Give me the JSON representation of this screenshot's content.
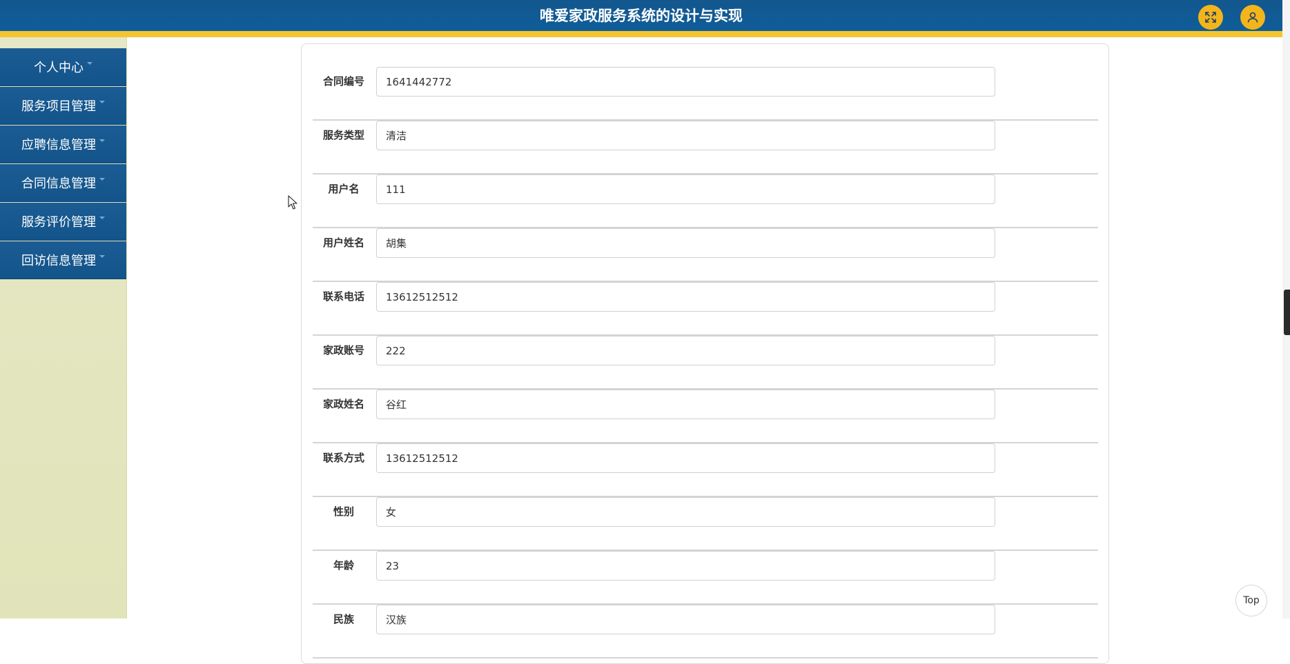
{
  "header": {
    "title": "唯爱家政服务系统的设计与实现",
    "fullscreen_icon": "fullscreen-icon",
    "user_icon": "user-icon"
  },
  "colors": {
    "header_blue": "#11589a",
    "accent_yellow": "#f5c52f",
    "menu_blue": "#13548b",
    "sidebar_bg": "#e4e5c0"
  },
  "sidebar": {
    "items": [
      {
        "label": "个人中心"
      },
      {
        "label": "服务项目管理"
      },
      {
        "label": "应聘信息管理"
      },
      {
        "label": "合同信息管理"
      },
      {
        "label": "服务评价管理"
      },
      {
        "label": "回访信息管理"
      }
    ]
  },
  "form": {
    "fields": [
      {
        "label": "合同编号",
        "value": "1641442772"
      },
      {
        "label": "服务类型",
        "value": "清洁"
      },
      {
        "label": "用户名",
        "value": "111"
      },
      {
        "label": "用户姓名",
        "value": "胡集"
      },
      {
        "label": "联系电话",
        "value": "13612512512"
      },
      {
        "label": "家政账号",
        "value": "222"
      },
      {
        "label": "家政姓名",
        "value": "谷红"
      },
      {
        "label": "联系方式",
        "value": "13612512512"
      },
      {
        "label": "性别",
        "value": "女"
      },
      {
        "label": "年龄",
        "value": "23"
      },
      {
        "label": "民族",
        "value": "汉族"
      }
    ]
  },
  "top_button": {
    "label": "Top"
  }
}
